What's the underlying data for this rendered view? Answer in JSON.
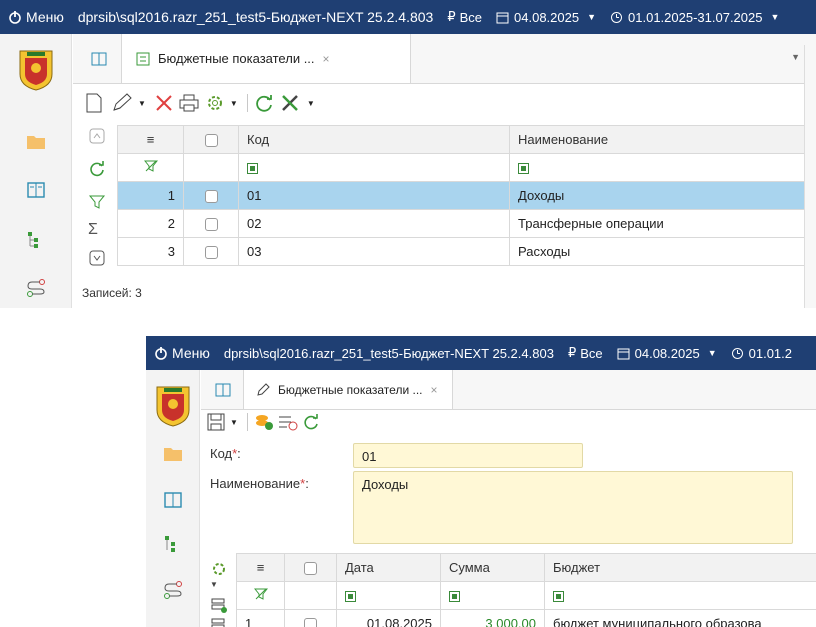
{
  "window": {
    "menu_label": "Меню",
    "path": "dprsib\\sql2016.razr_251_test5",
    "app": "Бюджет-NEXT 25.2.4.803",
    "budget_filter": "Все",
    "date": "04.08.2025",
    "period": "01.01.2025-31.07.2025",
    "period_partial": "01.01.2",
    "title_sep": " - "
  },
  "tab": {
    "label": "Бюджетные показатели ...",
    "close": "×"
  },
  "list_grid": {
    "columns": [
      "≡",
      "",
      "Код",
      "Наименование"
    ],
    "rows": [
      {
        "n": "1",
        "code": "01",
        "name": "Доходы",
        "selected": true
      },
      {
        "n": "2",
        "code": "02",
        "name": "Трансферные операции",
        "selected": false
      },
      {
        "n": "3",
        "code": "03",
        "name": "Расходы",
        "selected": false
      }
    ],
    "footer": "Записей: 3"
  },
  "form": {
    "code_label": "Код",
    "code_value": "01",
    "name_label": "Наименование",
    "name_value": "Доходы",
    "required_mark": "*",
    "label_suffix": ":"
  },
  "detail_grid": {
    "columns": [
      "≡",
      "",
      "Дата",
      "Сумма",
      "Бюджет"
    ],
    "rows": [
      {
        "n": "1",
        "date": "01.08.2025",
        "sum": "3 000,00",
        "budget": "бюджет муниципального образова"
      }
    ]
  },
  "colors": {
    "titlebar": "#1f3f73",
    "selected_row": "#a9d4ee",
    "required_field": "#fff8d6",
    "sum_text": "#2a8a2a",
    "delete_icon": "#e04040"
  },
  "icons": [
    "power-icon",
    "ruble-icon",
    "calendar-icon",
    "clock-icon",
    "emblem-logo",
    "folder-icon",
    "report-icon",
    "tree-icon",
    "route-icon",
    "new-icon",
    "edit-icon",
    "delete-icon",
    "print-icon",
    "settings-icon",
    "refresh-icon",
    "tools-icon",
    "save-icon",
    "filter-icon",
    "sum-icon",
    "search-icon",
    "scroll-up-icon",
    "scroll-down-icon"
  ]
}
